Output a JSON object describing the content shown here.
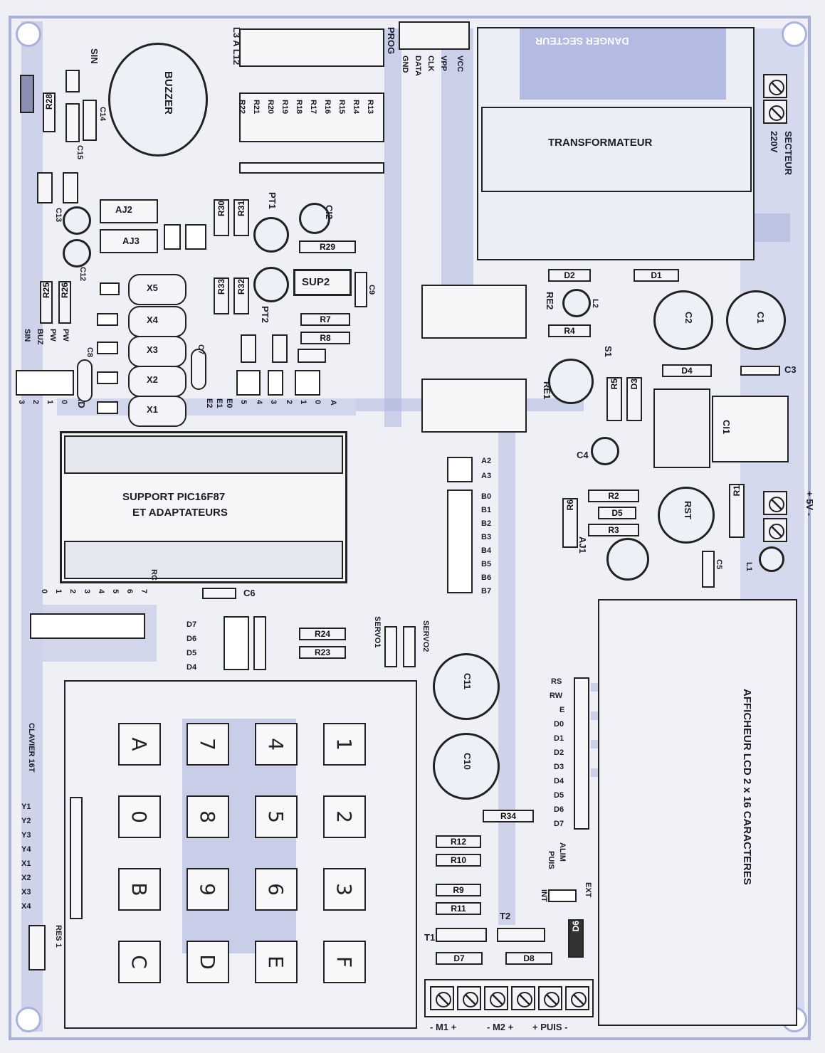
{
  "board": {
    "buzzer": "BUZZER",
    "sin": "SIN",
    "l3al12": "L3 A L12",
    "prog": "PROG",
    "gnd": "GND",
    "data": "DATA",
    "clk": "CLK",
    "vpp": "VPP",
    "vcc": "VCC",
    "danger": "DANGER SECTEUR",
    "transformateur": "TRANSFORMATEUR",
    "secteur": "SECTEUR",
    "v220": "220V",
    "plus5v": "+ 5V -",
    "support": "SUPPORT PIC16F87",
    "adaptateurs": "ET ADAPTATEURS",
    "afficheur": "AFFICHEUR LCD 2 x 16 CARACTERES",
    "clavier": "CLAVIER 16T",
    "res1": "RES 1",
    "m1": "- M1 +",
    "m2": "- M2 +",
    "puis": "+ PUIS -",
    "alim": "ALIM",
    "puis_lbl": "PUIS",
    "int": "INT",
    "ext": "EXT",
    "sup2": "SUP2",
    "rd": "RD",
    "rc": "RC",
    "buz": "BUZ",
    "pw": "PW",
    "plus": "+",
    "pt1": "PT1",
    "pt2": "PT2",
    "servo1": "SERVO1",
    "servo2": "SERVO2"
  },
  "resistors": {
    "r13": "R13",
    "r14": "R14",
    "r15": "R15",
    "r16": "R16",
    "r17": "R17",
    "r18": "R18",
    "r19": "R19",
    "r20": "R20",
    "r21": "R21",
    "r22": "R22",
    "r28": "R28",
    "r25": "R25",
    "r26": "R26",
    "r29": "R29",
    "r7": "R7",
    "r8": "R8",
    "r30": "R30",
    "r31": "R31",
    "r32": "R32",
    "r33": "R33",
    "r4": "R4",
    "r5": "R5",
    "r2": "R2",
    "r3": "R3",
    "r6": "R6",
    "r1": "R1",
    "r24": "R24",
    "r23": "R23",
    "r34": "R34",
    "r12": "R12",
    "r10": "R10",
    "r9": "R9",
    "r11": "R11"
  },
  "components": {
    "c14": "C14",
    "c15": "C15",
    "c13": "C13",
    "c12": "C12",
    "c8": "C8",
    "c7": "C7",
    "c9": "C9",
    "c2": "C2",
    "c1": "C1",
    "c3": "C3",
    "c4": "C4",
    "c5": "C5",
    "c6": "C6",
    "c11": "C11",
    "c10": "C10",
    "ci1": "CI1",
    "ci2": "CI2",
    "d1": "D1",
    "d2": "D2",
    "d3": "D3",
    "d4": "D4",
    "d5": "D5",
    "d6": "D6",
    "d7": "D7",
    "d8": "D8",
    "l1": "L1",
    "l2": "L2",
    "s1": "S1",
    "re1": "RE1",
    "re2": "RE2",
    "aj1": "AJ1",
    "aj2": "AJ2",
    "aj3": "AJ3",
    "rst": "RST",
    "t1": "T1",
    "t2": "T2",
    "x1": "X1",
    "x2": "X2",
    "x3": "X3",
    "x4": "X4",
    "x5": "X5"
  },
  "port_labels": {
    "a": [
      "A",
      "0",
      "1",
      "2",
      "3",
      "4",
      "5"
    ],
    "e": [
      "E0",
      "E1",
      "E2"
    ],
    "b": [
      "A2",
      "A3",
      "B0",
      "B1",
      "B2",
      "B3",
      "B4",
      "B5",
      "B6",
      "B7"
    ],
    "rc": [
      "0",
      "1",
      "2",
      "3",
      "4",
      "5",
      "6",
      "7"
    ],
    "rd": [
      "0",
      "1",
      "2",
      "3"
    ],
    "d_leds": [
      "D7",
      "D6",
      "D5",
      "D4"
    ],
    "lcd": [
      "RS",
      "RW",
      "E",
      "D0",
      "D1",
      "D2",
      "D3",
      "D4",
      "D5",
      "D6",
      "D7"
    ],
    "keypad_lines": [
      "Y1",
      "Y2",
      "Y3",
      "Y4",
      "X1",
      "X2",
      "X3",
      "X4"
    ]
  },
  "keypad": {
    "row1": [
      "1",
      "2",
      "3",
      "F"
    ],
    "row2": [
      "4",
      "5",
      "6",
      "E"
    ],
    "row3": [
      "7",
      "8",
      "9",
      "D"
    ],
    "row4": [
      "A",
      "0",
      "B",
      "C"
    ]
  },
  "colors": {
    "trace": "#a7afdc",
    "background": "#eef0f6",
    "ink": "#1c1d28"
  }
}
